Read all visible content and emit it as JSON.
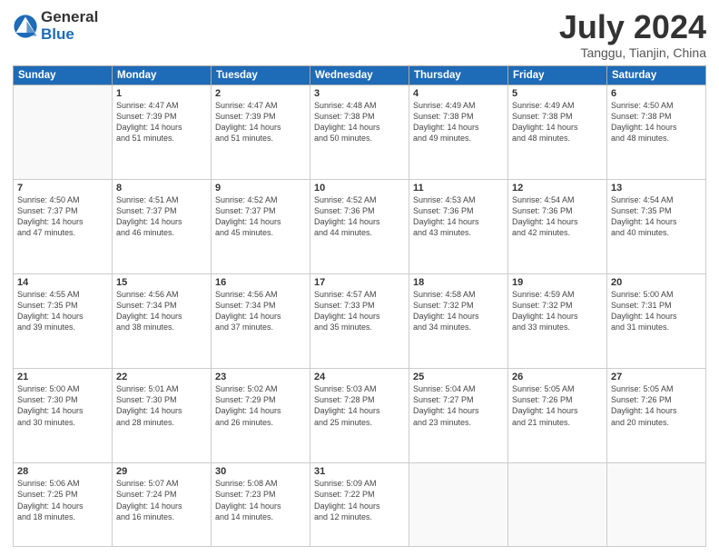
{
  "logo": {
    "general": "General",
    "blue": "Blue"
  },
  "title": "July 2024",
  "location": "Tanggu, Tianjin, China",
  "weekdays": [
    "Sunday",
    "Monday",
    "Tuesday",
    "Wednesday",
    "Thursday",
    "Friday",
    "Saturday"
  ],
  "weeks": [
    [
      {
        "day": "",
        "info": ""
      },
      {
        "day": "1",
        "info": "Sunrise: 4:47 AM\nSunset: 7:39 PM\nDaylight: 14 hours\nand 51 minutes."
      },
      {
        "day": "2",
        "info": "Sunrise: 4:47 AM\nSunset: 7:39 PM\nDaylight: 14 hours\nand 51 minutes."
      },
      {
        "day": "3",
        "info": "Sunrise: 4:48 AM\nSunset: 7:38 PM\nDaylight: 14 hours\nand 50 minutes."
      },
      {
        "day": "4",
        "info": "Sunrise: 4:49 AM\nSunset: 7:38 PM\nDaylight: 14 hours\nand 49 minutes."
      },
      {
        "day": "5",
        "info": "Sunrise: 4:49 AM\nSunset: 7:38 PM\nDaylight: 14 hours\nand 48 minutes."
      },
      {
        "day": "6",
        "info": "Sunrise: 4:50 AM\nSunset: 7:38 PM\nDaylight: 14 hours\nand 48 minutes."
      }
    ],
    [
      {
        "day": "7",
        "info": "Sunrise: 4:50 AM\nSunset: 7:37 PM\nDaylight: 14 hours\nand 47 minutes."
      },
      {
        "day": "8",
        "info": "Sunrise: 4:51 AM\nSunset: 7:37 PM\nDaylight: 14 hours\nand 46 minutes."
      },
      {
        "day": "9",
        "info": "Sunrise: 4:52 AM\nSunset: 7:37 PM\nDaylight: 14 hours\nand 45 minutes."
      },
      {
        "day": "10",
        "info": "Sunrise: 4:52 AM\nSunset: 7:36 PM\nDaylight: 14 hours\nand 44 minutes."
      },
      {
        "day": "11",
        "info": "Sunrise: 4:53 AM\nSunset: 7:36 PM\nDaylight: 14 hours\nand 43 minutes."
      },
      {
        "day": "12",
        "info": "Sunrise: 4:54 AM\nSunset: 7:36 PM\nDaylight: 14 hours\nand 42 minutes."
      },
      {
        "day": "13",
        "info": "Sunrise: 4:54 AM\nSunset: 7:35 PM\nDaylight: 14 hours\nand 40 minutes."
      }
    ],
    [
      {
        "day": "14",
        "info": "Sunrise: 4:55 AM\nSunset: 7:35 PM\nDaylight: 14 hours\nand 39 minutes."
      },
      {
        "day": "15",
        "info": "Sunrise: 4:56 AM\nSunset: 7:34 PM\nDaylight: 14 hours\nand 38 minutes."
      },
      {
        "day": "16",
        "info": "Sunrise: 4:56 AM\nSunset: 7:34 PM\nDaylight: 14 hours\nand 37 minutes."
      },
      {
        "day": "17",
        "info": "Sunrise: 4:57 AM\nSunset: 7:33 PM\nDaylight: 14 hours\nand 35 minutes."
      },
      {
        "day": "18",
        "info": "Sunrise: 4:58 AM\nSunset: 7:32 PM\nDaylight: 14 hours\nand 34 minutes."
      },
      {
        "day": "19",
        "info": "Sunrise: 4:59 AM\nSunset: 7:32 PM\nDaylight: 14 hours\nand 33 minutes."
      },
      {
        "day": "20",
        "info": "Sunrise: 5:00 AM\nSunset: 7:31 PM\nDaylight: 14 hours\nand 31 minutes."
      }
    ],
    [
      {
        "day": "21",
        "info": "Sunrise: 5:00 AM\nSunset: 7:30 PM\nDaylight: 14 hours\nand 30 minutes."
      },
      {
        "day": "22",
        "info": "Sunrise: 5:01 AM\nSunset: 7:30 PM\nDaylight: 14 hours\nand 28 minutes."
      },
      {
        "day": "23",
        "info": "Sunrise: 5:02 AM\nSunset: 7:29 PM\nDaylight: 14 hours\nand 26 minutes."
      },
      {
        "day": "24",
        "info": "Sunrise: 5:03 AM\nSunset: 7:28 PM\nDaylight: 14 hours\nand 25 minutes."
      },
      {
        "day": "25",
        "info": "Sunrise: 5:04 AM\nSunset: 7:27 PM\nDaylight: 14 hours\nand 23 minutes."
      },
      {
        "day": "26",
        "info": "Sunrise: 5:05 AM\nSunset: 7:26 PM\nDaylight: 14 hours\nand 21 minutes."
      },
      {
        "day": "27",
        "info": "Sunrise: 5:05 AM\nSunset: 7:26 PM\nDaylight: 14 hours\nand 20 minutes."
      }
    ],
    [
      {
        "day": "28",
        "info": "Sunrise: 5:06 AM\nSunset: 7:25 PM\nDaylight: 14 hours\nand 18 minutes."
      },
      {
        "day": "29",
        "info": "Sunrise: 5:07 AM\nSunset: 7:24 PM\nDaylight: 14 hours\nand 16 minutes."
      },
      {
        "day": "30",
        "info": "Sunrise: 5:08 AM\nSunset: 7:23 PM\nDaylight: 14 hours\nand 14 minutes."
      },
      {
        "day": "31",
        "info": "Sunrise: 5:09 AM\nSunset: 7:22 PM\nDaylight: 14 hours\nand 12 minutes."
      },
      {
        "day": "",
        "info": ""
      },
      {
        "day": "",
        "info": ""
      },
      {
        "day": "",
        "info": ""
      }
    ]
  ]
}
